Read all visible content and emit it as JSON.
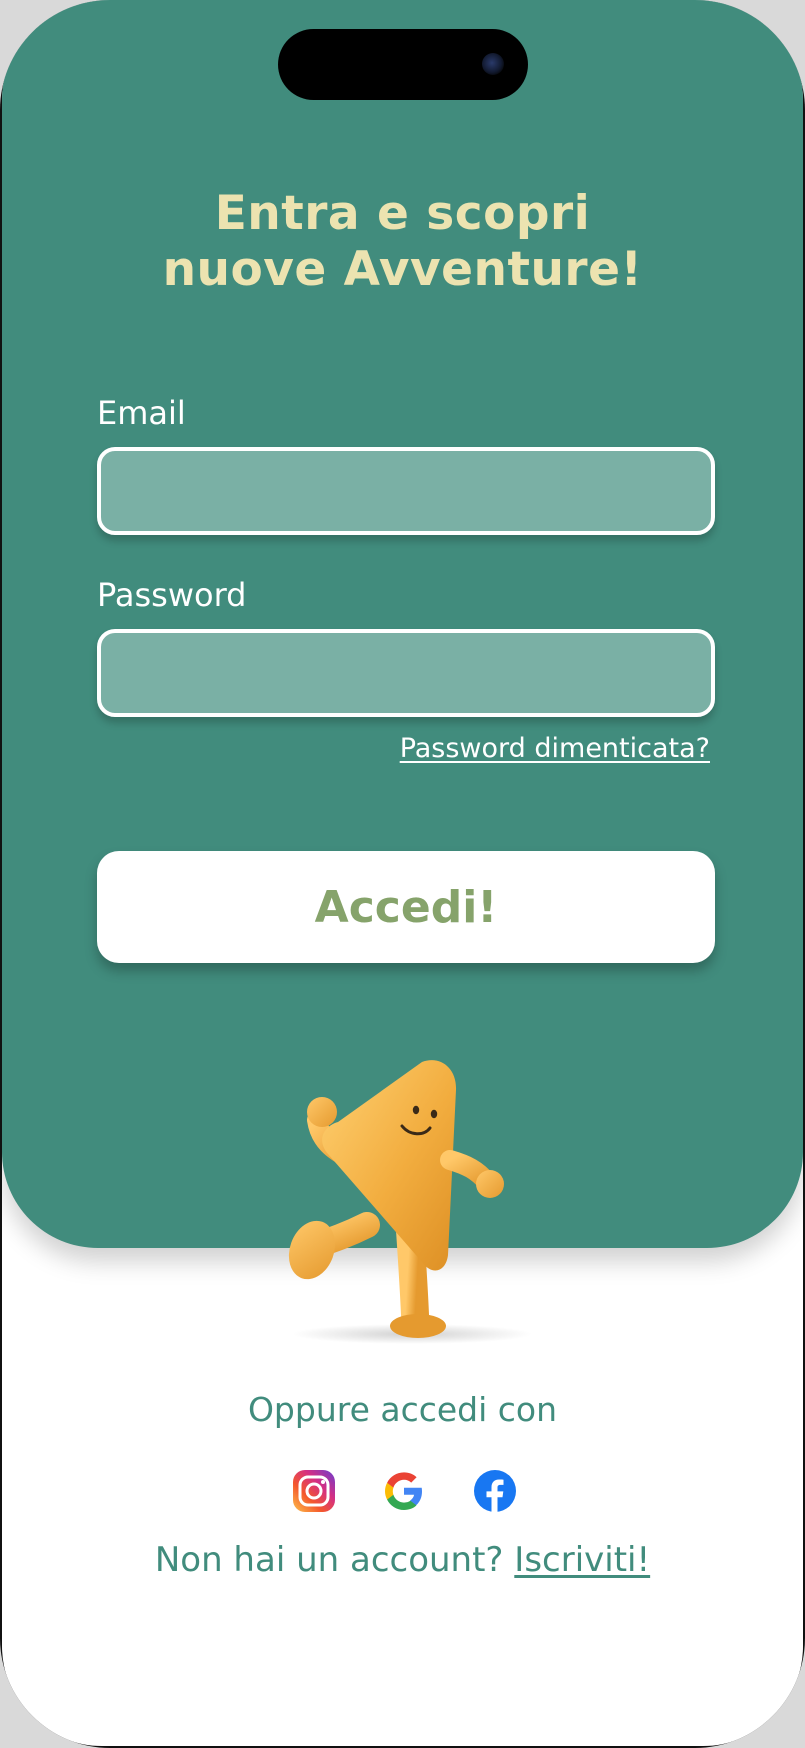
{
  "login": {
    "title_line1": "Entra e scopri",
    "title_line2": "nuove Avventure!",
    "email_label": "Email",
    "email_value": "",
    "password_label": "Password",
    "password_value": "",
    "forgot_password": "Password dimenticata?",
    "submit_label": "Accedi!"
  },
  "alternate": {
    "prompt": "Oppure accedi con",
    "providers": [
      {
        "name": "instagram-icon"
      },
      {
        "name": "google-icon"
      },
      {
        "name": "facebook-icon"
      }
    ]
  },
  "signup": {
    "question": "Non hai un account?",
    "link": "Iscriviti!"
  },
  "colors": {
    "primary": "#418c7d",
    "field_fill": "#7ab0a5",
    "title": "#ece3b0",
    "button_text": "#86a36b",
    "mascot": "#f2ad3f"
  }
}
